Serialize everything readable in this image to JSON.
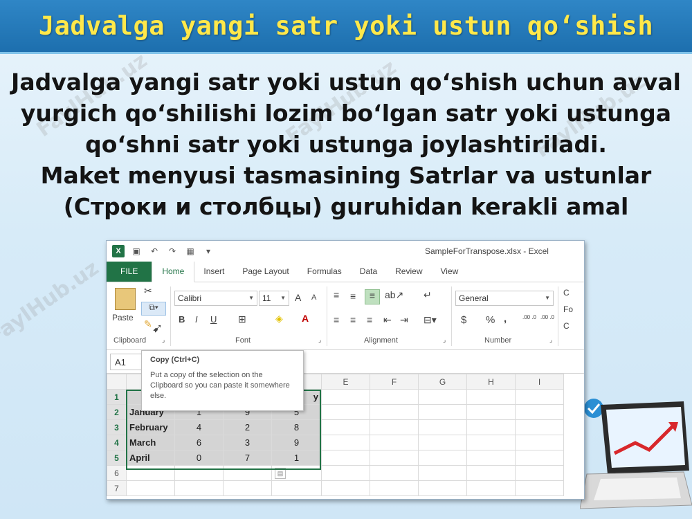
{
  "slide": {
    "title": "Jadvalga yangi satr yoki ustun qo‘shish",
    "paragraph1": "Jadvalga yangi satr yoki ustun qo‘shish uchun avval yurgich qo‘shilishi lozim bo‘lgan satr yoki ustunga qo‘shni satr yoki ustunga joylashtiriladi.",
    "paragraph2": "Maket menyusi tasmasining Satrlar va ustunlar (Строки и столбцы) guruhidan kerakli amal",
    "watermark": "FaylHub.uz"
  },
  "excel": {
    "window_title": "SampleForTranspose.xlsx - Excel",
    "logo_text": "X",
    "tabs": [
      "FILE",
      "Home",
      "Insert",
      "Page Layout",
      "Formulas",
      "Data",
      "Review",
      "View"
    ],
    "active_tab": "Home",
    "clipboard": {
      "paste_label": "Paste",
      "group_label": "Clipboard"
    },
    "font": {
      "name": "Calibri",
      "size": "11",
      "group_label": "Font",
      "bold": "B",
      "italic": "I",
      "underline": "U",
      "grow": "A",
      "shrink": "A"
    },
    "alignment": {
      "group_label": "Alignment"
    },
    "number": {
      "format": "General",
      "group_label": "Number",
      "currency": "$",
      "percent": "%",
      "comma": ",",
      "inc_decimal": ".00 .0",
      "dec_decimal": ".00 .0"
    },
    "styles_partial": [
      "C",
      "Fo",
      "C"
    ],
    "name_box": "A1",
    "tooltip": {
      "title": "Copy (Ctrl+C)",
      "body": "Put a copy of the selection on the Clipboard so you can paste it somewhere else."
    },
    "columns": [
      "E",
      "F",
      "G",
      "H",
      "I"
    ],
    "header_partial": "y",
    "rows": [
      {
        "num": "1",
        "label": "",
        "b": "",
        "c": "",
        "d": ""
      },
      {
        "num": "2",
        "label": "January",
        "b": "1",
        "c": "9",
        "d": "5"
      },
      {
        "num": "3",
        "label": "February",
        "b": "4",
        "c": "2",
        "d": "8"
      },
      {
        "num": "4",
        "label": "March",
        "b": "6",
        "c": "3",
        "d": "9"
      },
      {
        "num": "5",
        "label": "April",
        "b": "0",
        "c": "7",
        "d": "1"
      },
      {
        "num": "6",
        "label": "",
        "b": "",
        "c": "",
        "d": ""
      },
      {
        "num": "7",
        "label": "",
        "b": "",
        "c": "",
        "d": ""
      }
    ]
  },
  "colors": {
    "excel_green": "#217346",
    "title_yellow": "#ffe84a",
    "title_bar": "#1d6fae"
  }
}
